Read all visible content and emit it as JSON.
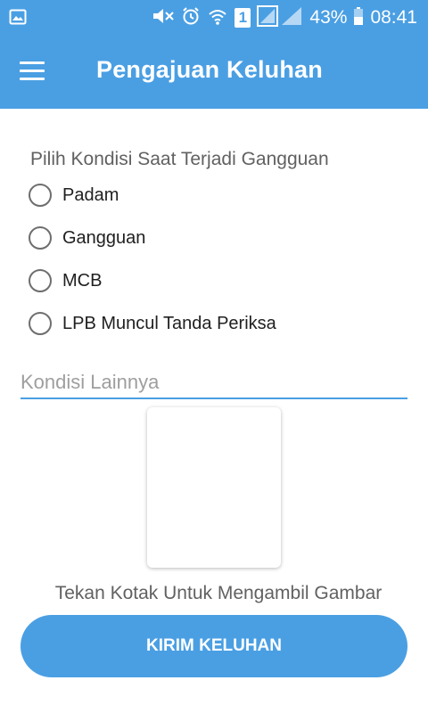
{
  "status_bar": {
    "battery": "43%",
    "time": "08:41",
    "sim_slot": "1",
    "icons": [
      "image-icon",
      "mute-icon",
      "alarm-icon",
      "wifi-icon",
      "sim-icon",
      "signal-icon",
      "battery-icon"
    ]
  },
  "app_bar": {
    "title": "Pengajuan Keluhan",
    "menu_icon": "hamburger-menu-icon"
  },
  "form": {
    "condition_title": "Pilih Kondisi Saat Terjadi Gangguan",
    "options": [
      {
        "label": "Padam",
        "selected": false
      },
      {
        "label": "Gangguan",
        "selected": false
      },
      {
        "label": "MCB",
        "selected": false
      },
      {
        "label": "LPB Muncul Tanda Periksa",
        "selected": false
      }
    ],
    "other_condition": {
      "placeholder": "Kondisi Lainnya",
      "value": ""
    },
    "photo_hint": "Tekan Kotak Untuk Mengambil Gambar",
    "submit_label": "KIRIM KELUHAN"
  },
  "colors": {
    "primary": "#4a9fe3",
    "text_secondary": "#616161",
    "text_primary": "#202020"
  }
}
